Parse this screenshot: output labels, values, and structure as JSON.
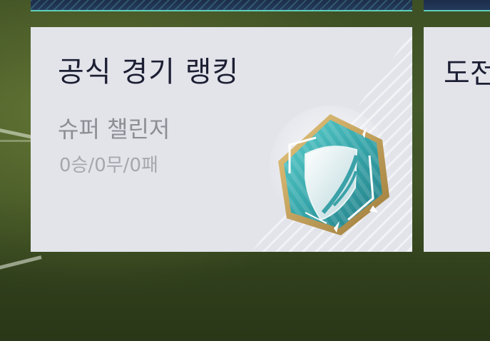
{
  "cards": [
    {
      "title": "공식 경기 랭킹",
      "rank_name": "슈퍼 챌린저",
      "record": "0승/0무/0패",
      "badge_icon": "super-challenger-shield-badge"
    },
    {
      "title": "도전"
    }
  ],
  "colors": {
    "card_bg": "#e3e4ea",
    "title": "#1c1f33",
    "rank": "#8d8e95",
    "record": "#a6a7ae",
    "badge_teal": "#3fb6b4",
    "badge_gold": "#c9a35a",
    "strip_accent": "#5fd0ba"
  }
}
